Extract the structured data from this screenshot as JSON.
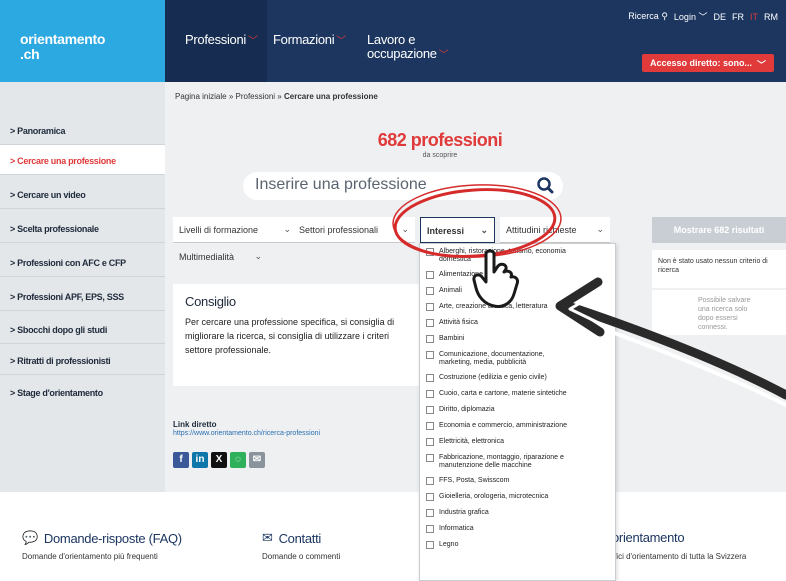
{
  "header": {
    "logo_line1": "orientamento",
    "logo_line2": ".ch",
    "nav": [
      {
        "label": "Professioni"
      },
      {
        "label": "Formazioni"
      },
      {
        "label_line1": "Lavoro e",
        "label_line2": "occupazione"
      }
    ],
    "util": {
      "search": "Ricerca",
      "login": "Login",
      "langs": [
        "DE",
        "FR",
        "IT",
        "RM"
      ]
    },
    "accesso_label": "Accesso diretto: sono..."
  },
  "sidebar": {
    "items": [
      {
        "label": "Panoramica"
      },
      {
        "label": "Cercare una professione"
      },
      {
        "label": "Cercare un video"
      },
      {
        "label": "Scelta professionale"
      },
      {
        "label": "Professioni con AFC e CFP"
      },
      {
        "label": "Professioni APF, EPS, SSS"
      },
      {
        "label": "Sbocchi dopo gli studi"
      },
      {
        "label": "Ritratti di professionisti"
      },
      {
        "label": "Stage d'orientamento"
      }
    ]
  },
  "main": {
    "breadcrumb": {
      "part1": "Pagina iniziale",
      "part2": "Professioni",
      "current": "Cercare una professione"
    },
    "count": "682 professioni",
    "count_sub": "da scoprire",
    "search_placeholder": "Inserire una professione",
    "filters": {
      "livelli": "Livelli di formazione",
      "settori": "Settori professionali",
      "interessi": "Interessi",
      "attitudini": "Attitudini richieste",
      "multimedialita": "Multimedialità"
    },
    "mostrare": "Mostrare 682 risultati",
    "note": "Non è stato usato nessun criterio di ricerca",
    "note2": "Possibile salvare una ricerca solo dopo essersi connessi.",
    "consiglio_title": "Consiglio",
    "consiglio_lines": [
      "Per cercare una professione specifica, si consiglia di",
      "migliorare la ricerca, si consiglia di utilizzare i criteri",
      "settore professionale."
    ],
    "link_label": "Link diretto",
    "link_url": "https://www.orientamento.ch/ricerca-professioni"
  },
  "dropdown": {
    "items": [
      {
        "line1": "Alberghi, ristorazione, turismo, economia",
        "line2": "domestica"
      },
      {
        "line1": "Alimentazione"
      },
      {
        "line1": "Animali"
      },
      {
        "line1": "Arte, creazione artistica, letteratura"
      },
      {
        "line1": "Attività fisica"
      },
      {
        "line1": "Bambini"
      },
      {
        "line1": "Comunicazione, documentazione,",
        "line2": "marketing, media, pubblicità"
      },
      {
        "line1": "Costruzione (edilizia e genio civile)"
      },
      {
        "line1": "Cuoio, carta e cartone, materie sintetiche"
      },
      {
        "line1": "Diritto, diplomazia"
      },
      {
        "line1": "Economia e commercio, amministrazione"
      },
      {
        "line1": "Elettricità, elettronica"
      },
      {
        "line1": "Fabbricazione, montaggio, riparazione e",
        "line2": "manutenzione delle macchine"
      },
      {
        "line1": "FFS, Posta, Swisscom"
      },
      {
        "line1": "Gioielleria, orologeria, microtecnica"
      },
      {
        "line1": "Industria grafica"
      },
      {
        "line1": "Informatica"
      },
      {
        "line1": "Legno"
      }
    ]
  },
  "footer": {
    "faq_title": "Domande-risposte (FAQ)",
    "faq_sub": "Domande d'orientamento più frequenti",
    "contatti_title": "Contatti",
    "contatti_sub": "Domande o commenti",
    "orient_title": "orientamento",
    "orient_sub": "ffici d'orientamento di tutta la Svizzera"
  },
  "colors": {
    "brand_blue": "#1c3660",
    "accent_red": "#e03a3a",
    "logo_cyan": "#2da9e1"
  },
  "icons": [
    "search-icon",
    "chevron-down-icon",
    "facebook-icon",
    "linkedin-icon",
    "x-icon",
    "whatsapp-icon",
    "mail-icon",
    "chat-icon",
    "envelope-icon",
    "hand-cursor-icon",
    "arrow-annotation",
    "circle-annotation"
  ]
}
